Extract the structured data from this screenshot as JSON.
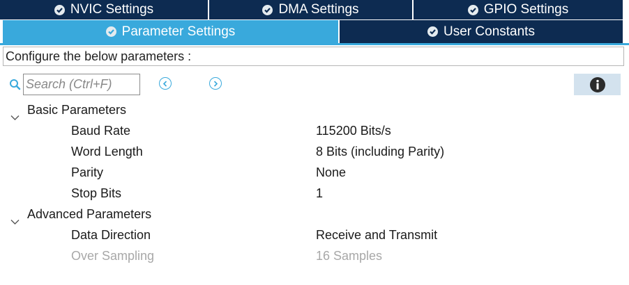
{
  "tabs_row1": [
    {
      "label": "NVIC Settings"
    },
    {
      "label": "DMA Settings"
    },
    {
      "label": "GPIO Settings"
    }
  ],
  "tabs_row2": [
    {
      "label": "Parameter Settings",
      "active": true
    },
    {
      "label": "User Constants",
      "active": false
    }
  ],
  "description": "Configure the below parameters :",
  "search": {
    "placeholder": "Search (Ctrl+F)"
  },
  "icons": {
    "search": "search-icon",
    "prev": "chevron-left-circle-icon",
    "next": "chevron-right-circle-icon",
    "info": "info-icon",
    "check": "check-circle-icon",
    "expand": "chevron-down-icon"
  },
  "groups": [
    {
      "label": "Basic Parameters",
      "params": [
        {
          "name": "Baud Rate",
          "value": "115200 Bits/s",
          "enabled": true
        },
        {
          "name": "Word Length",
          "value": "8 Bits (including Parity)",
          "enabled": true
        },
        {
          "name": "Parity",
          "value": "None",
          "enabled": true
        },
        {
          "name": "Stop Bits",
          "value": "1",
          "enabled": true
        }
      ]
    },
    {
      "label": "Advanced Parameters",
      "params": [
        {
          "name": "Data Direction",
          "value": "Receive and Transmit",
          "enabled": true
        },
        {
          "name": "Over Sampling",
          "value": "16 Samples",
          "enabled": false
        }
      ]
    }
  ],
  "colors": {
    "tab_dark": "#0d2b51",
    "tab_active": "#39a9dc",
    "accent": "#39a9dc",
    "disabled_text": "#a8a8a8",
    "info_bg": "#d3e2ee"
  }
}
